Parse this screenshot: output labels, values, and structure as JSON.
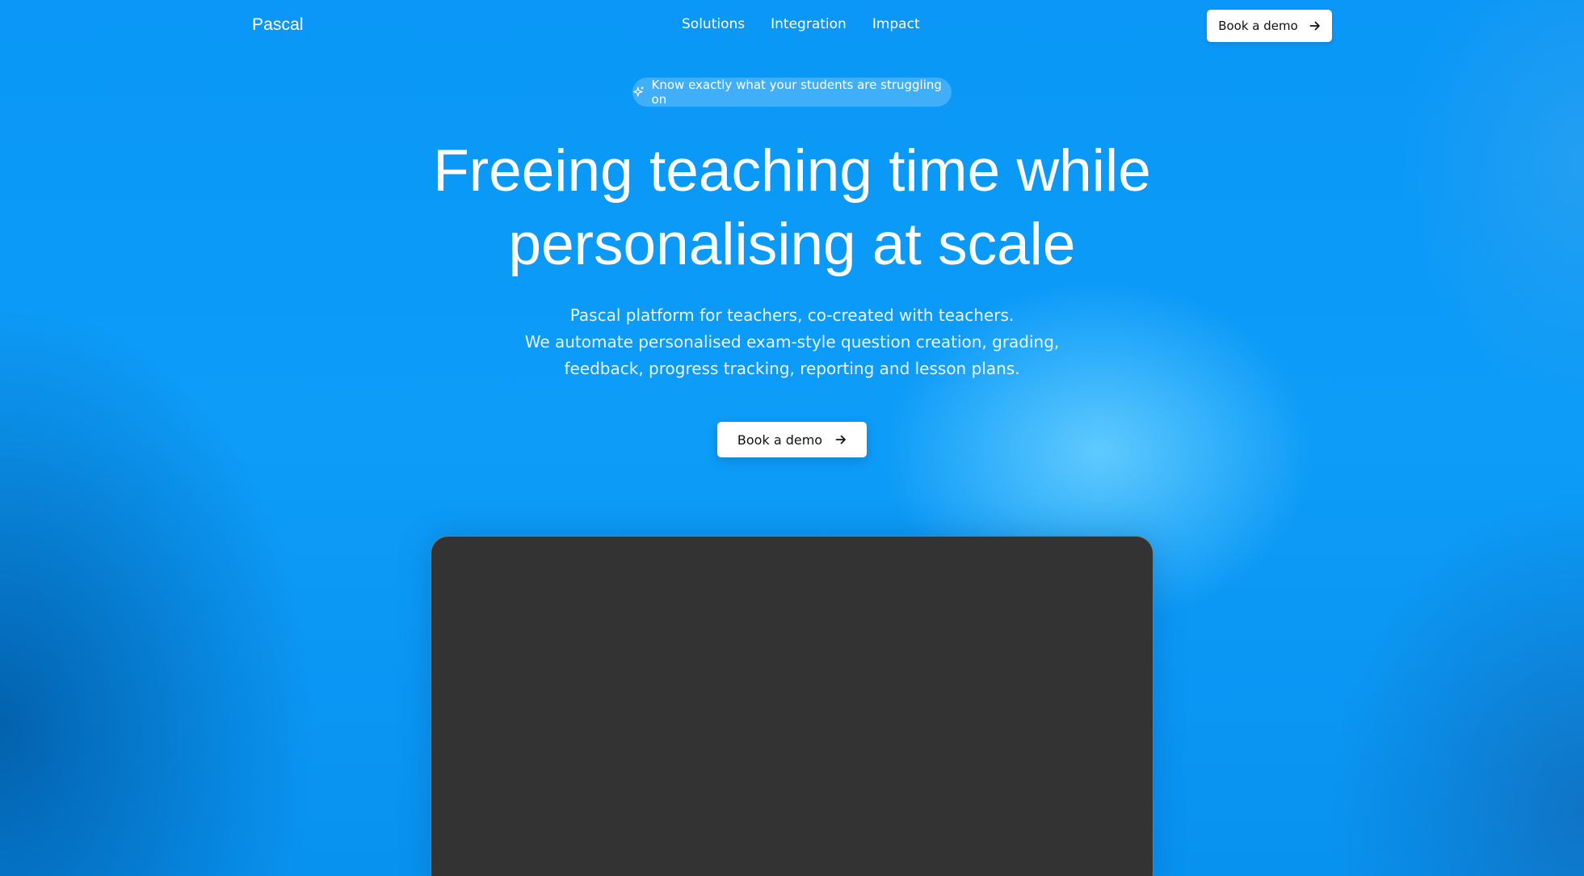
{
  "nav": {
    "logo": "Pascal",
    "links": [
      "Solutions",
      "Integration",
      "Impact"
    ],
    "cta_label": "Book a demo",
    "cta_icon": "arrow-right-icon"
  },
  "hero": {
    "badge_icon": "sparkle-icon",
    "badge_text": "Know exactly what your students are struggling on",
    "headline_line1": "Freeing teaching time while",
    "headline_line2": "personalising at scale",
    "subtitle_line1": "Pascal platform for teachers, co-created with teachers.",
    "subtitle_line2": "We automate personalised exam-style question creation, grading,",
    "subtitle_line3": "feedback, progress tracking, reporting and lesson plans.",
    "cta_label": "Book a demo",
    "cta_icon": "arrow-right-icon"
  },
  "colors": {
    "background": "#0896f5",
    "preview_panel": "#333333",
    "button_bg": "#ffffff",
    "button_text": "#111111"
  }
}
